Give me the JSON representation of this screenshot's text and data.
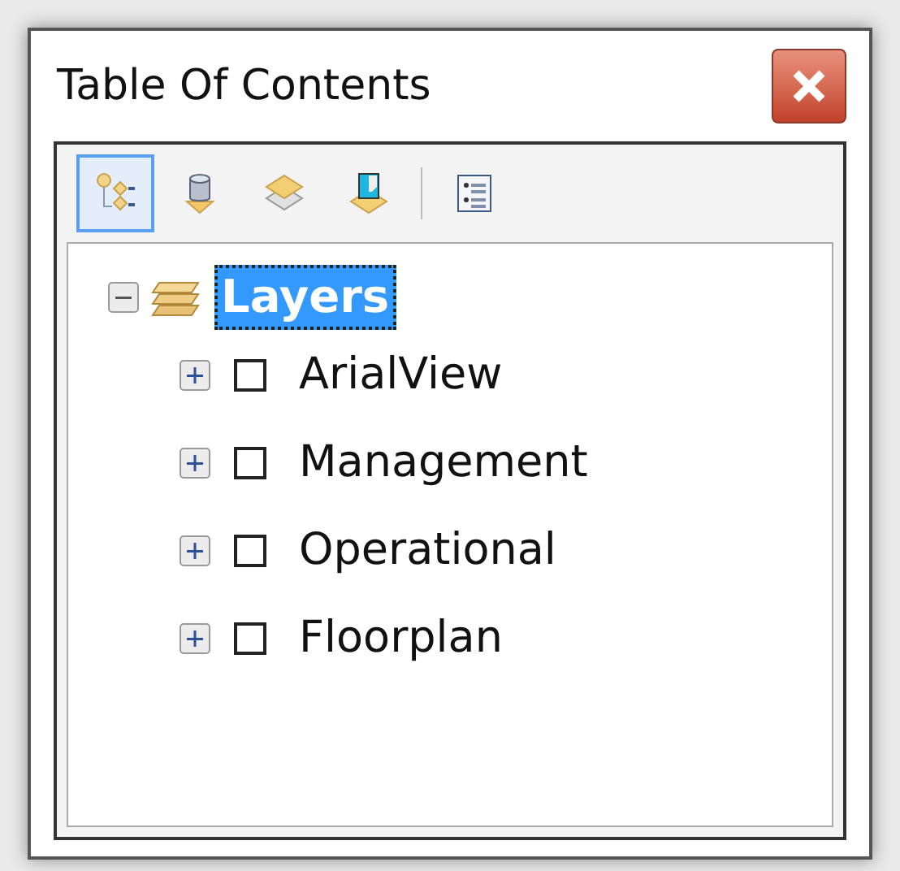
{
  "window": {
    "title": "Table Of Contents"
  },
  "toolbar": [
    {
      "kind": "drawing-order",
      "selected": true
    },
    {
      "kind": "source",
      "selected": false
    },
    {
      "kind": "visibility",
      "selected": false
    },
    {
      "kind": "selection",
      "selected": false
    },
    {
      "kind": "options",
      "selected": false
    }
  ],
  "tree": {
    "label": "Layers",
    "expanded": true,
    "selected": true,
    "children": [
      {
        "label": "ArialView",
        "expanded": false,
        "checked": false
      },
      {
        "label": "Management",
        "expanded": false,
        "checked": false
      },
      {
        "label": "Operational",
        "expanded": false,
        "checked": false
      },
      {
        "label": "Floorplan",
        "expanded": false,
        "checked": false
      }
    ]
  }
}
